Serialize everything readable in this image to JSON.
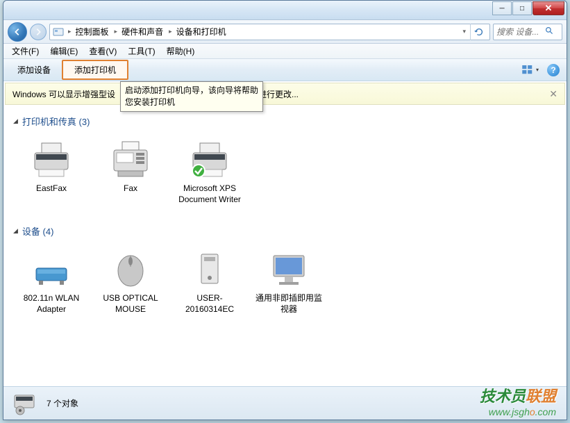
{
  "titlebar": {
    "minimize": "─",
    "maximize": "□",
    "close": "✕"
  },
  "breadcrumb": {
    "items": [
      "控制面板",
      "硬件和声音",
      "设备和打印机"
    ],
    "arrow": "▸"
  },
  "search": {
    "placeholder": "搜索 设备..."
  },
  "menubar": {
    "items": [
      "文件(F)",
      "编辑(E)",
      "查看(V)",
      "工具(T)",
      "帮助(H)"
    ]
  },
  "toolbar": {
    "add_device": "添加设备",
    "add_printer": "添加打印机"
  },
  "tooltip": {
    "text": "启动添加打印机向导，该向导将帮助您安装打印机"
  },
  "infobar": {
    "text": "Windows 可以显示增强型设",
    "text_after": "进行更改...",
    "close": "✕"
  },
  "groups": {
    "printers": {
      "title": "打印机和传真 (3)",
      "items": [
        {
          "label": "EastFax",
          "icon": "printer"
        },
        {
          "label": "Fax",
          "icon": "fax"
        },
        {
          "label": "Microsoft XPS Document Writer",
          "icon": "printer-default"
        }
      ]
    },
    "devices": {
      "title": "设备 (4)",
      "items": [
        {
          "label": "802.11n WLAN Adapter",
          "icon": "adapter"
        },
        {
          "label": "USB OPTICAL MOUSE",
          "icon": "mouse"
        },
        {
          "label": "USER-20160314EC",
          "icon": "computer"
        },
        {
          "label": "通用非即插即用监视器",
          "icon": "monitor"
        }
      ]
    }
  },
  "statusbar": {
    "count": "7 个对象"
  },
  "watermark": {
    "main_part1": "技术员",
    "main_part2": "联盟",
    "url_prefix": "www.jsgh",
    "url_o": "o",
    "url_suffix": ".com"
  }
}
